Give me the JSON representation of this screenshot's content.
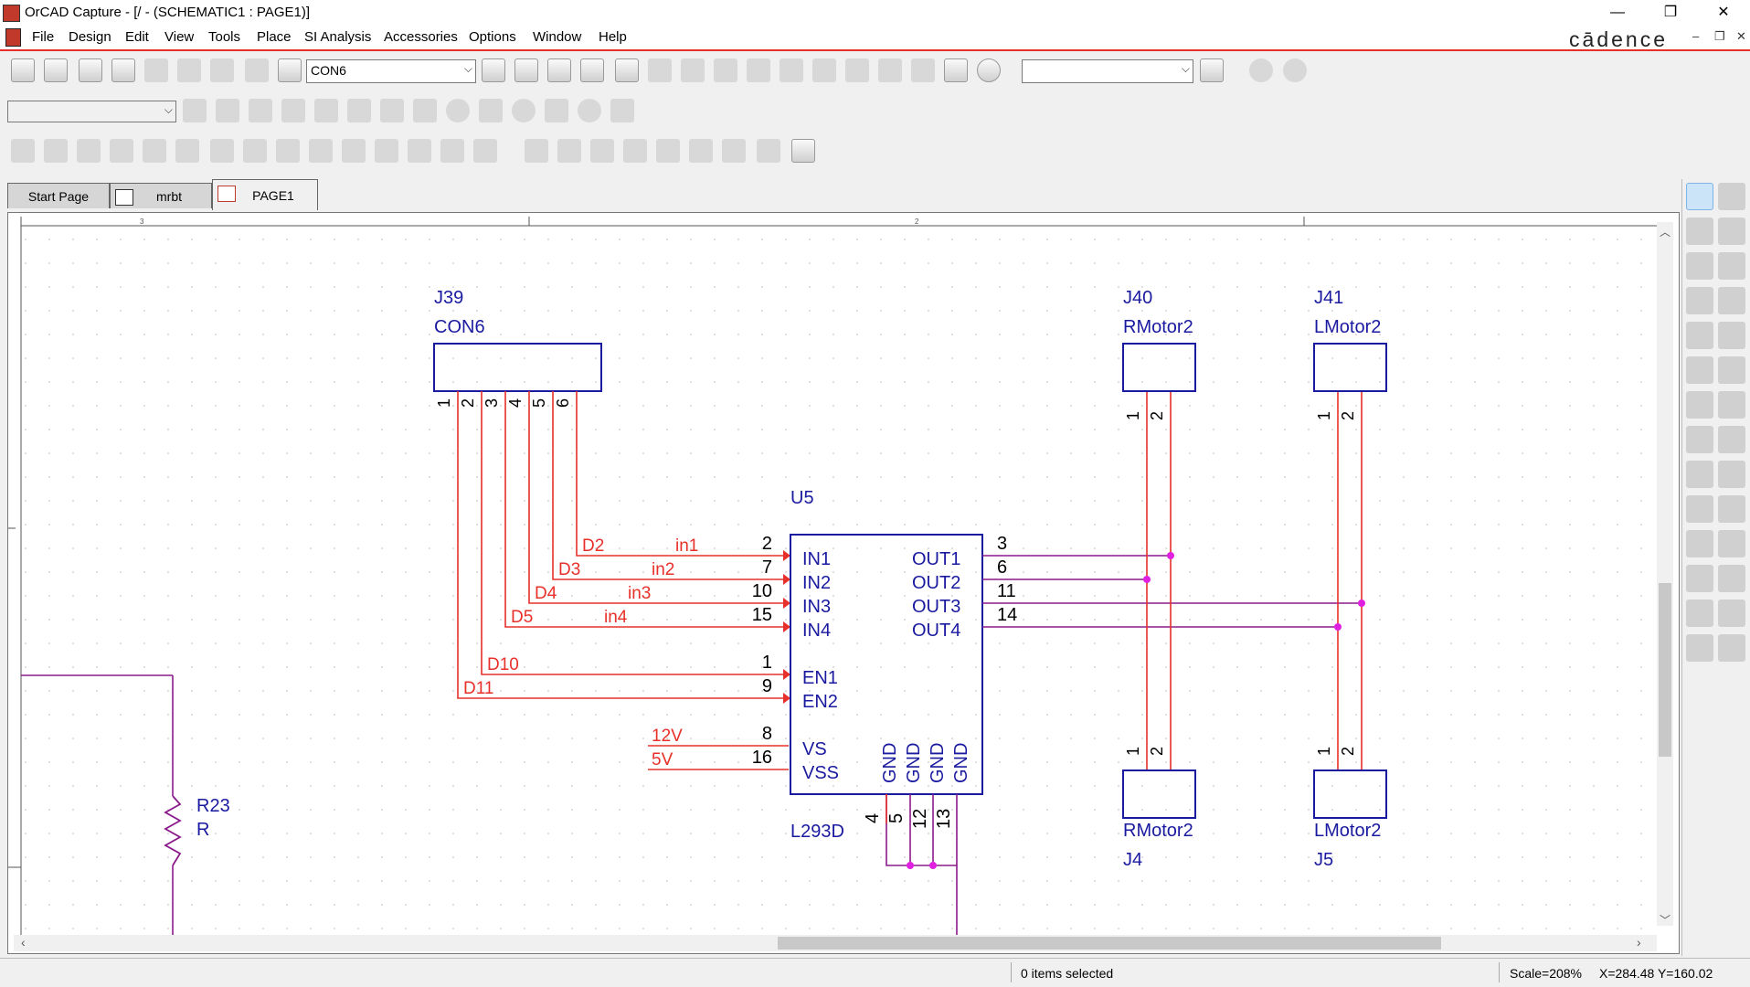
{
  "window": {
    "title": "OrCAD Capture - [/ - (SCHEMATIC1 : PAGE1)]",
    "minimize": "—",
    "restore": "❐",
    "close": "✕"
  },
  "menu": {
    "items": [
      "File",
      "Design",
      "Edit",
      "View",
      "Tools",
      "Place",
      "SI Analysis",
      "Accessories",
      "Options",
      "Window",
      "Help"
    ],
    "brand": "cādence",
    "mdi_min": "–",
    "mdi_restore": "❐",
    "mdi_close": "✕"
  },
  "toolbar": {
    "part_combo": "CON6",
    "search_combo": "",
    "sim_combo": ""
  },
  "tabs": [
    {
      "label": "Start Page"
    },
    {
      "label": "mrbt"
    },
    {
      "label": "PAGE1"
    }
  ],
  "schematic": {
    "ruler_marks": [
      "3",
      "2"
    ],
    "j39": {
      "ref": "J39",
      "value": "CON6",
      "pins": [
        "1",
        "2",
        "3",
        "4",
        "5",
        "6"
      ]
    },
    "j40": {
      "ref": "J40",
      "value": "RMotor2",
      "pins": [
        "1",
        "2"
      ]
    },
    "j41": {
      "ref": "J41",
      "value": "LMotor2",
      "pins": [
        "1",
        "2"
      ]
    },
    "j4": {
      "ref": "J4",
      "value": "RMotor2",
      "pins": [
        "1",
        "2"
      ]
    },
    "j5": {
      "ref": "J5",
      "value": "LMotor2",
      "pins": [
        "1",
        "2"
      ]
    },
    "u5": {
      "ref": "U5",
      "part": "L293D",
      "left_pins": [
        {
          "name": "IN1",
          "num": "2",
          "net": "D2",
          "alias": "in1"
        },
        {
          "name": "IN2",
          "num": "7",
          "net": "D3",
          "alias": "in2"
        },
        {
          "name": "IN3",
          "num": "10",
          "net": "D4",
          "alias": "in3"
        },
        {
          "name": "IN4",
          "num": "15",
          "net": "D5",
          "alias": "in4"
        },
        {
          "name": "EN1",
          "num": "1",
          "net": "D10",
          "alias": ""
        },
        {
          "name": "EN2",
          "num": "9",
          "net": "D11",
          "alias": ""
        },
        {
          "name": "VS",
          "num": "8",
          "net": "12V",
          "alias": ""
        },
        {
          "name": "VSS",
          "num": "16",
          "net": "5V",
          "alias": ""
        }
      ],
      "right_pins": [
        {
          "name": "OUT1",
          "num": "3"
        },
        {
          "name": "OUT2",
          "num": "6"
        },
        {
          "name": "OUT3",
          "num": "11"
        },
        {
          "name": "OUT4",
          "num": "14"
        }
      ],
      "gnd_pins": [
        {
          "name": "GND",
          "num": "4"
        },
        {
          "name": "GND",
          "num": "5"
        },
        {
          "name": "GND",
          "num": "12"
        },
        {
          "name": "GND",
          "num": "13"
        }
      ]
    },
    "r23": {
      "ref": "R23",
      "value": "R"
    }
  },
  "status": {
    "selection": "0 items selected",
    "scale": "Scale=208%",
    "coords": "X=284.48  Y=160.02"
  },
  "colors": {
    "wire": "#e8302a",
    "part": "#1a1aa0",
    "bus": "#8a1a8a",
    "junction": "#e020e0",
    "text": "#000000"
  }
}
